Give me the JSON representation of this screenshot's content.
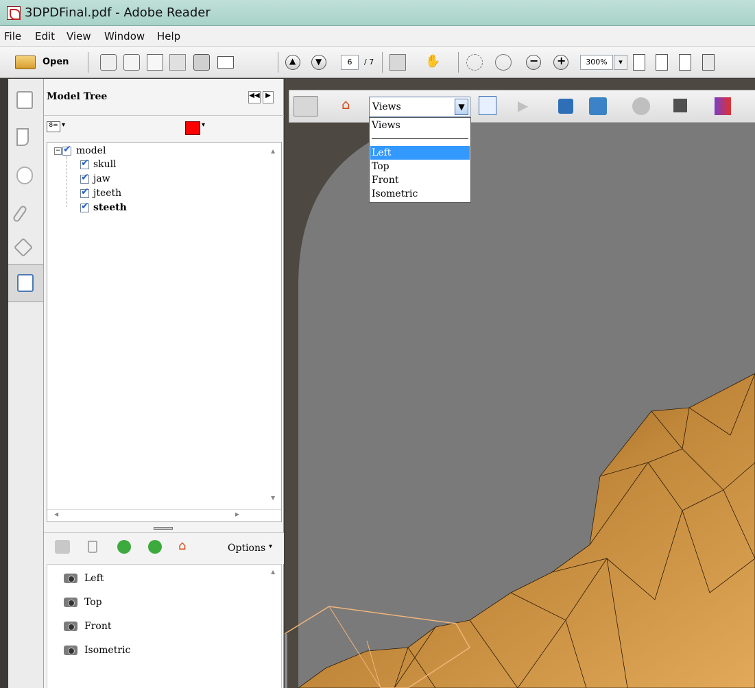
{
  "window": {
    "title": "3DPDFinal.pdf - Adobe Reader"
  },
  "menu": [
    "File",
    "Edit",
    "View",
    "Window",
    "Help"
  ],
  "toolbar": {
    "open_label": "Open",
    "page_current": "6",
    "page_total": "/ 7",
    "zoom": "300%"
  },
  "model_tree": {
    "title": "Model Tree",
    "root": "model",
    "children": [
      "skull",
      "jaw",
      "jteeth",
      "steeth"
    ],
    "selected": "steeth"
  },
  "views_panel": {
    "options_label": "Options",
    "views": [
      "Left",
      "Top",
      "Front",
      "Isometric"
    ]
  },
  "viewer": {
    "views_select": "Views",
    "dropdown": {
      "header": "Views",
      "items": [
        "Left",
        "Top",
        "Front",
        "Isometric"
      ],
      "selected": "Left"
    }
  },
  "colors": {
    "background_3d": "#7a7a7a",
    "model": "#b07b32",
    "tree_color_swatch": "#ff0000",
    "selection": "#3399ff"
  }
}
